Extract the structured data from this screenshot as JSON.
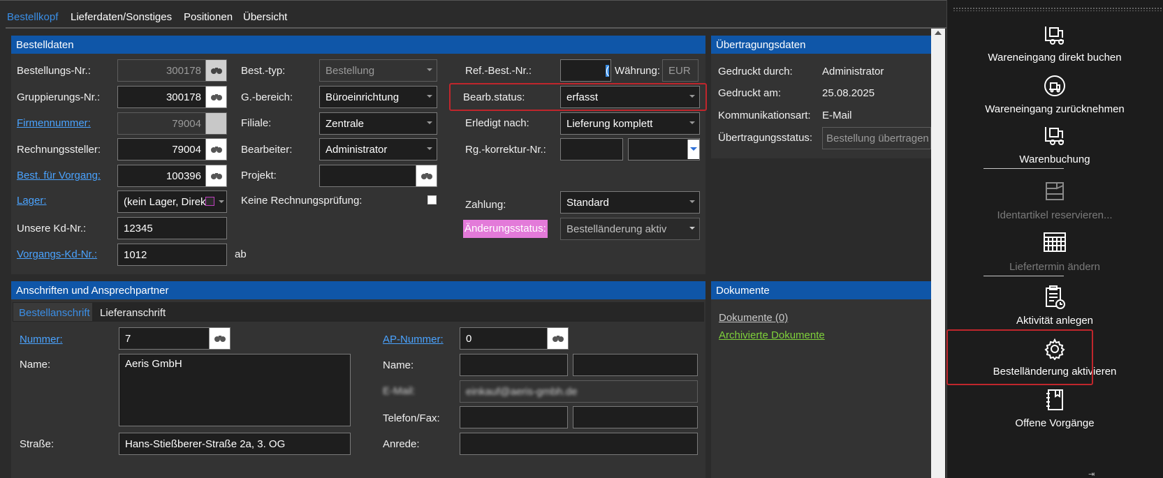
{
  "tabs": [
    "Bestellkopf",
    "Lieferdaten/Sonstiges",
    "Positionen",
    "Übersicht"
  ],
  "bestelldaten": {
    "header": "Bestelldaten",
    "bestellungs_nr_label": "Bestellungs-Nr.:",
    "bestellungs_nr": "300178",
    "gruppierungs_nr_label": "Gruppierungs-Nr.:",
    "gruppierungs_nr": "300178",
    "firmennummer_label": "Firmennummer:",
    "firmennummer": "79004",
    "rechnungssteller_label": "Rechnungssteller:",
    "rechnungssteller": "79004",
    "best_vorgang_label": "Best. für Vorgang:",
    "best_vorgang": "100396",
    "lager_label": "Lager:",
    "lager": "(kein Lager, Direk",
    "unsere_kd_label": "Unsere Kd-Nr.:",
    "unsere_kd": "12345",
    "vorgangs_kd_label": "Vorgangs-Kd-Nr.:",
    "vorgangs_kd": "1012",
    "vorgangs_kd_suffix": "ab",
    "best_typ_label": "Best.-typ:",
    "best_typ": "Bestellung",
    "g_bereich_label": "G.-bereich:",
    "g_bereich": "Büroeinrichtung",
    "filiale_label": "Filiale:",
    "filiale": "Zentrale",
    "bearbeiter_label": "Bearbeiter:",
    "bearbeiter": "Administrator",
    "projekt_label": "Projekt:",
    "projekt": "",
    "keine_rp_label": "Keine Rechnungsprüfung:",
    "ref_best_label": "Ref.-Best.-Nr.:",
    "ref_best": "(",
    "waehrung_label": "Währung:",
    "waehrung": "EUR",
    "bearb_status_label": "Bearb.status:",
    "bearb_status": "erfasst",
    "erledigt_label": "Erledigt nach:",
    "erledigt": "Lieferung komplett",
    "rg_korrektur_label": "Rg.-korrektur-Nr.:",
    "rg_korrektur": "",
    "zahlung_label": "Zahlung:",
    "zahlung": "Standard",
    "aenderungsstatus_label": "Änderungsstatus:",
    "aenderungsstatus": "Bestelländerung aktiv"
  },
  "uebertragungsdaten": {
    "header": "Übertragungsdaten",
    "gedruckt_durch_label": "Gedruckt durch:",
    "gedruckt_durch": "Administrator",
    "gedruckt_am_label": "Gedruckt am:",
    "gedruckt_am": "25.08.2025",
    "kommunikationsart_label": "Kommunikationsart:",
    "kommunikationsart": "E-Mail",
    "uebertragungsstatus_label": "Übertragungsstatus:",
    "uebertragungsstatus": "Bestellung übertragen"
  },
  "anschriften": {
    "header": "Anschriften und Ansprechpartner",
    "subtabs": [
      "Bestellanschrift",
      "Lieferanschrift"
    ],
    "nummer_label": "Nummer:",
    "nummer": "7",
    "name_label": "Name:",
    "name": "Aeris GmbH",
    "strasse_label": "Straße:",
    "strasse": "Hans-Stießberer-Straße 2a, 3. OG",
    "ap_nummer_label": "AP-Nummer:",
    "ap_nummer": "0",
    "ap_name_label": "Name:",
    "email_label": "E-Mail:",
    "email": "einkauf@aeris-gmbh.de",
    "telefon_label": "Telefon/Fax:",
    "anrede_label": "Anrede:"
  },
  "dokumente": {
    "header": "Dokumente",
    "dokumente_link": "Dokumente (0)",
    "archivierte_link": "Archivierte Dokumente"
  },
  "sidepane": [
    {
      "label": "Wareneingang direkt buchen",
      "icon": "forklift-icon",
      "enabled": true
    },
    {
      "label": "Wareneingang zurücknehmen",
      "icon": "return-goods-icon",
      "enabled": true
    },
    {
      "label": "Warenbuchung",
      "icon": "forklift-icon",
      "enabled": true
    },
    {
      "label": "Identartikel reservieren...",
      "icon": "reserve-icon",
      "enabled": false
    },
    {
      "label": "Liefertermin ändern",
      "icon": "calendar-icon",
      "enabled": false
    },
    {
      "label": "Aktivität anlegen",
      "icon": "clipboard-clock-icon",
      "enabled": true
    },
    {
      "label": "Bestelländerung aktivieren",
      "icon": "gear-icon",
      "enabled": true
    },
    {
      "label": "Offene Vorgänge",
      "icon": "notebook-icon",
      "enabled": true
    }
  ],
  "colors": {
    "accent_blue": "#0f56a8",
    "link_blue": "#4aa3ff",
    "link_green": "#7fd13b",
    "highlight_pink": "#e37ad9",
    "red_outline": "#c0262c"
  }
}
